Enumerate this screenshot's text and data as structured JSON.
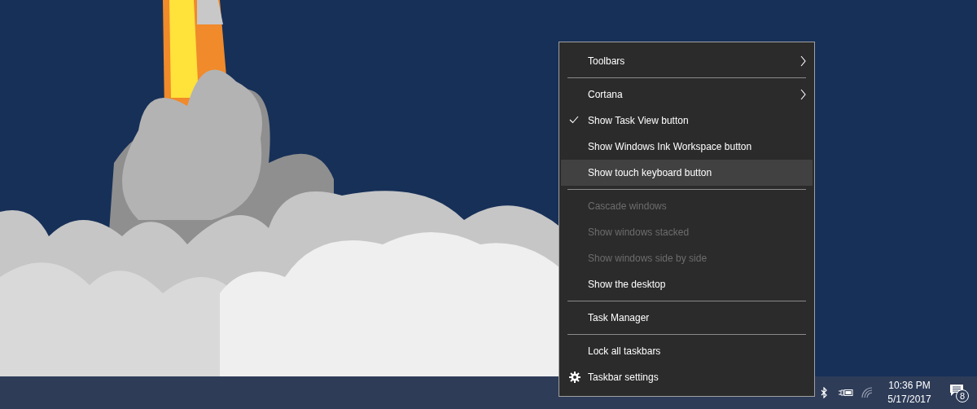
{
  "context_menu": {
    "items": [
      {
        "kind": "item",
        "label": "Toolbars",
        "submenu": true,
        "checked": false,
        "disabled": false,
        "selected": false
      },
      {
        "kind": "separator"
      },
      {
        "kind": "item",
        "label": "Cortana",
        "submenu": true,
        "checked": false,
        "disabled": false,
        "selected": false
      },
      {
        "kind": "item",
        "label": "Show Task View button",
        "submenu": false,
        "checked": true,
        "disabled": false,
        "selected": false
      },
      {
        "kind": "item",
        "label": "Show Windows Ink Workspace button",
        "submenu": false,
        "checked": false,
        "disabled": false,
        "selected": false
      },
      {
        "kind": "item",
        "label": "Show touch keyboard button",
        "submenu": false,
        "checked": false,
        "disabled": false,
        "selected": true
      },
      {
        "kind": "separator"
      },
      {
        "kind": "item",
        "label": "Cascade windows",
        "submenu": false,
        "checked": false,
        "disabled": true,
        "selected": false
      },
      {
        "kind": "item",
        "label": "Show windows stacked",
        "submenu": false,
        "checked": false,
        "disabled": true,
        "selected": false
      },
      {
        "kind": "item",
        "label": "Show windows side by side",
        "submenu": false,
        "checked": false,
        "disabled": true,
        "selected": false
      },
      {
        "kind": "item",
        "label": "Show the desktop",
        "submenu": false,
        "checked": false,
        "disabled": false,
        "selected": false
      },
      {
        "kind": "separator"
      },
      {
        "kind": "item",
        "label": "Task Manager",
        "submenu": false,
        "checked": false,
        "disabled": false,
        "selected": false
      },
      {
        "kind": "separator"
      },
      {
        "kind": "item",
        "label": "Lock all taskbars",
        "submenu": false,
        "checked": false,
        "disabled": false,
        "selected": false
      },
      {
        "kind": "settings",
        "label": "Taskbar settings",
        "submenu": false,
        "checked": false,
        "disabled": false,
        "selected": false
      }
    ]
  },
  "taskbar": {
    "clock": {
      "time": "10:36 PM",
      "date": "5/17/2017"
    },
    "notifications": {
      "count": "8"
    }
  }
}
